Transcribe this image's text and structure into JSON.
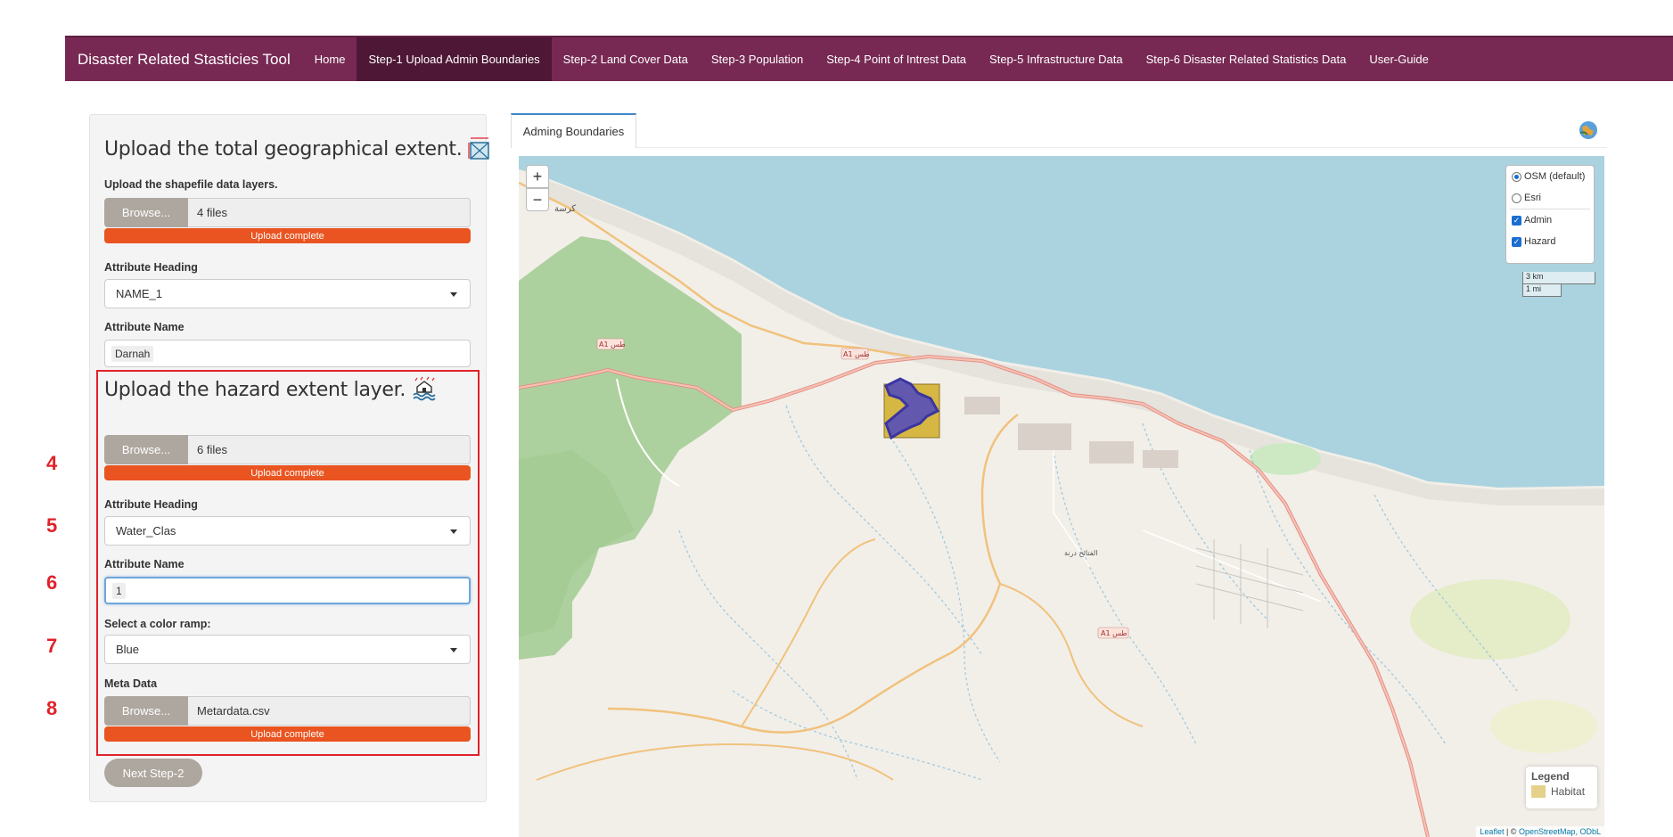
{
  "navbar": {
    "brand": "Disaster Related Stasticies Tool",
    "items": [
      {
        "label": "Home",
        "active": false
      },
      {
        "label": "Step-1 Upload Admin Boundaries",
        "active": true
      },
      {
        "label": "Step-2 Land Cover Data",
        "active": false
      },
      {
        "label": "Step-3 Population",
        "active": false
      },
      {
        "label": "Step-4 Point of Intrest Data",
        "active": false
      },
      {
        "label": "Step-5 Infrastructure Data",
        "active": false
      },
      {
        "label": "Step-6 Disaster Related Statistics Data",
        "active": false
      },
      {
        "label": "User-Guide",
        "active": false
      }
    ]
  },
  "extent": {
    "title": "Upload the total geographical extent.",
    "upload_label": "Upload the shapefile data layers.",
    "browse": "Browse...",
    "files": "4 files",
    "progress": "Upload complete",
    "heading_label": "Attribute Heading",
    "heading_value": "NAME_1",
    "name_label": "Attribute Name",
    "name_value": "Darnah"
  },
  "hazard": {
    "title": "Upload the hazard extent layer.",
    "browse": "Browse...",
    "files": "6 files",
    "progress": "Upload complete",
    "heading_label": "Attribute Heading",
    "heading_value": "Water_Clas",
    "name_label": "Attribute Name",
    "name_value": "1",
    "ramp_label": "Select a color ramp:",
    "ramp_value": "Blue",
    "meta_label": "Meta Data",
    "meta_browse": "Browse...",
    "meta_file": "Metardata.csv",
    "meta_progress": "Upload complete"
  },
  "step_numbers": [
    "4",
    "5",
    "6",
    "7",
    "8"
  ],
  "next_button": "Next Step-2",
  "tab": "Adming Boundaries",
  "map": {
    "zoom_in": "+",
    "zoom_out": "−",
    "base_layers": [
      "OSM (default)",
      "Esri"
    ],
    "overlays": [
      "Admin",
      "Hazard"
    ],
    "scale_km": "3 km",
    "scale_mi": "1 mi",
    "legend_title": "Legend",
    "legend_item": "Habitat",
    "attribution_leaflet": "Leaflet",
    "attribution_sep": " | © ",
    "attribution_osm": "OpenStreetMap, ODbL",
    "place_labels": [
      "كرسة",
      "A1 طس",
      "A1 طس",
      "الفتائح درنة",
      "A1 طس"
    ],
    "colors": {
      "sea": "#aad3df",
      "land": "#f2efe9",
      "forest": "#add19e",
      "road": "#f1a76b",
      "hazard": "#5c53b4",
      "admin": "#d4b032"
    }
  }
}
